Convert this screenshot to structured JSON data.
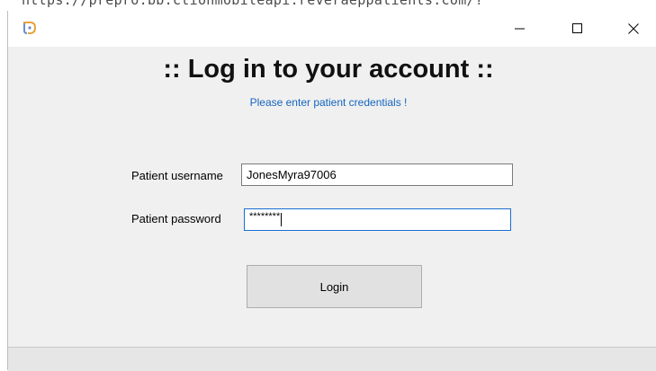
{
  "background": {
    "url_fragment": "https://prepro.bb.ctionmobileapi.reveraeppatients.com/?"
  },
  "window": {
    "title": "",
    "controls": {
      "minimize": "minimize",
      "maximize": "maximize",
      "close": "close"
    }
  },
  "form": {
    "heading": ":: Log in to your account ::",
    "subheading": "Please enter patient credentials !",
    "username": {
      "label": "Patient username",
      "value": "JonesMyra97006"
    },
    "password": {
      "label": "Patient password",
      "masked_value": "********"
    },
    "login_label": "Login"
  },
  "colors": {
    "window_bg": "#f0f0f0",
    "subtitle_color": "#1565c0",
    "focus_border": "#1a6fd1",
    "button_bg": "#e1e1e1"
  },
  "icons": {
    "app": "app-logo-icon",
    "minimize": "minimize-icon",
    "maximize": "maximize-icon",
    "close": "close-icon"
  }
}
